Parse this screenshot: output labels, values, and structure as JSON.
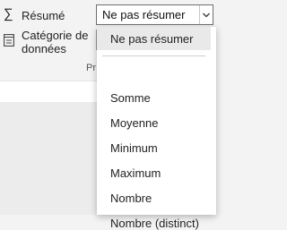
{
  "summary_row": {
    "icon": "sigma-icon",
    "label": "Résumé",
    "selected_value": "Ne pas résumer"
  },
  "category_row": {
    "icon": "data-category-icon",
    "label_line1": "Catégorie de",
    "label_line2": "données"
  },
  "group_label": "Pr",
  "dropdown": {
    "highlighted": "Ne pas résumer",
    "options": [
      "Somme",
      "Moyenne",
      "Minimum",
      "Maximum",
      "Nombre",
      "Nombre (distinct)"
    ]
  },
  "colors": {
    "ribbon_background": "#f3f3f3",
    "dropdown_background": "#ffffff",
    "highlight_background": "#e9e9e9",
    "border": "#6f6f6f"
  }
}
